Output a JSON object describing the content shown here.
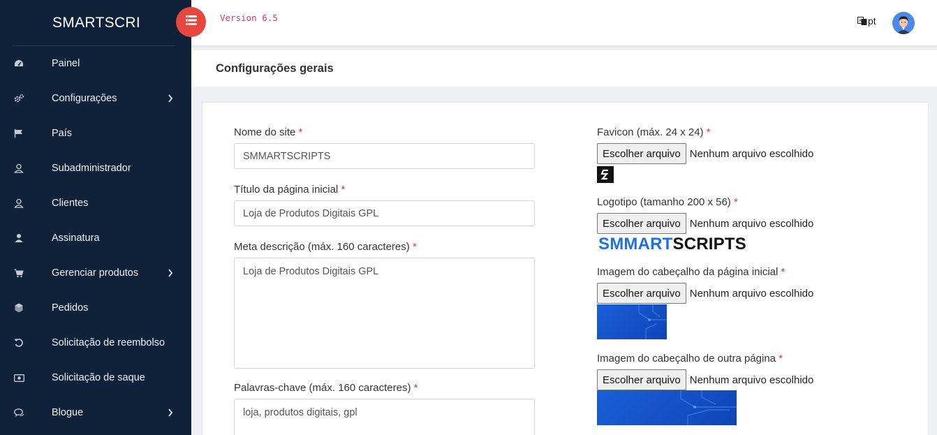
{
  "brand": "SMARTSCRI",
  "version": "Version 6.5",
  "language": "pt",
  "page_title": "Configurações gerais",
  "sidebar": {
    "items": [
      {
        "label": "Painel",
        "icon": "dashboard-icon",
        "chevron": false
      },
      {
        "label": "Configurações",
        "icon": "gears-icon",
        "chevron": true
      },
      {
        "label": "País",
        "icon": "flag-icon",
        "chevron": false
      },
      {
        "label": "Subadministrador",
        "icon": "user-outline-icon",
        "chevron": false
      },
      {
        "label": "Clientes",
        "icon": "user-outline-icon",
        "chevron": false
      },
      {
        "label": "Assinatura",
        "icon": "user-solid-icon",
        "chevron": false
      },
      {
        "label": "Gerenciar produtos",
        "icon": "cart-icon",
        "chevron": true
      },
      {
        "label": "Pedidos",
        "icon": "cube-icon",
        "chevron": false
      },
      {
        "label": "Solicitação de reembolso",
        "icon": "undo-icon",
        "chevron": false
      },
      {
        "label": "Solicitação de saque",
        "icon": "money-icon",
        "chevron": false
      },
      {
        "label": "Blogue",
        "icon": "chat-icon",
        "chevron": true
      }
    ]
  },
  "form": {
    "site_name": {
      "label": "Nome do site",
      "required": "*",
      "value": "SMMARTSCRIPTS"
    },
    "home_title": {
      "label": "Título da página inicial",
      "required": "*",
      "value": "Loja de Produtos Digitais GPL"
    },
    "meta_description": {
      "label": "Meta descrição (máx. 160 caracteres)",
      "required": "*",
      "value": "Loja de Produtos Digitais GPL"
    },
    "keywords": {
      "label": "Palavras-chave (máx. 160 caracteres)",
      "required": "*",
      "value": "loja, produtos digitais, gpl"
    },
    "favicon": {
      "label": "Favicon (máx. 24 x 24)",
      "required": "*"
    },
    "logo": {
      "label": "Logotipo (tamanho 200 x 56)",
      "required": "*",
      "logo_a": "SMMART",
      "logo_b": "SCRIPTS"
    },
    "home_header": {
      "label": "Imagem do cabeçalho da página inicial",
      "required": "*"
    },
    "other_header": {
      "label": "Imagem do cabeçalho de outra página",
      "required": "*"
    },
    "file_button": "Escolher arquivo",
    "no_file": "Nenhum arquivo escolhido"
  },
  "colors": {
    "sidebar_bg": "#0f2239",
    "toggle": "#e8473f",
    "version_text": "#d6336c",
    "logo_blue": "#1f6fe5",
    "required": "#dc3545"
  }
}
